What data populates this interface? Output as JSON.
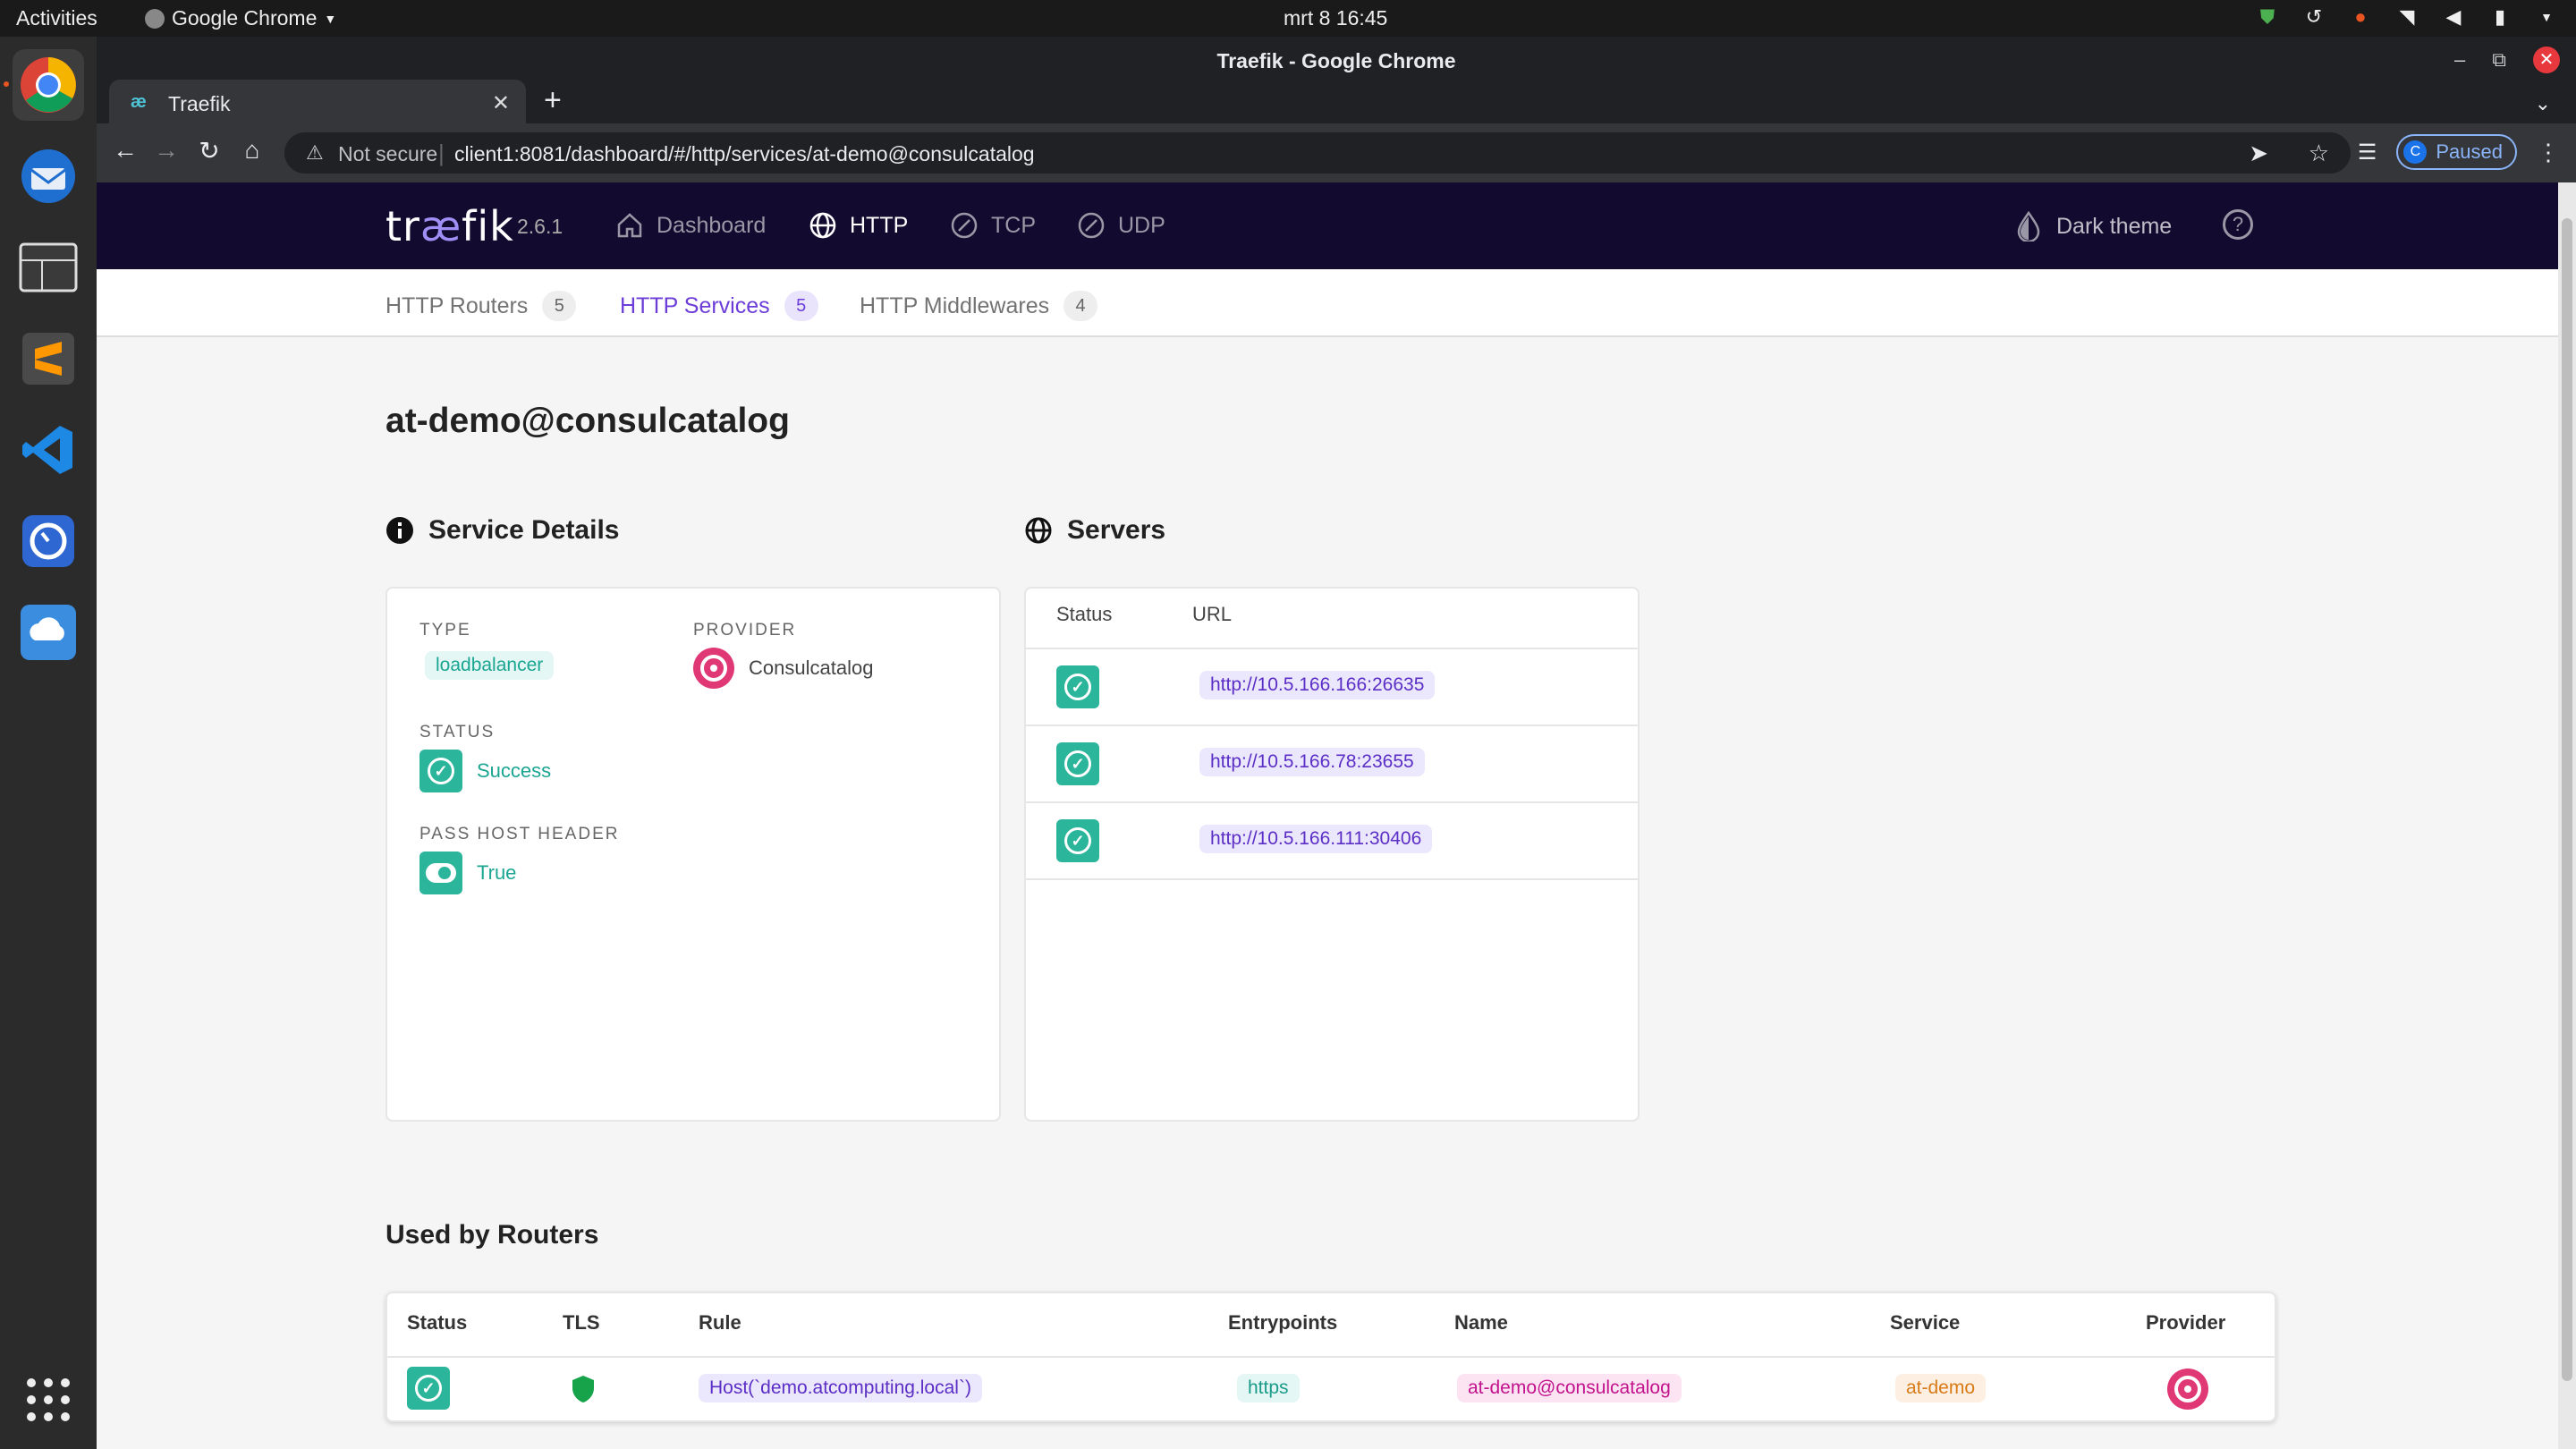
{
  "os": {
    "activities": "Activities",
    "app_menu": "Google Chrome",
    "clock": "mrt 8  16:45"
  },
  "window": {
    "title": "Traefik - Google Chrome",
    "tab_title": "Traefik",
    "not_secure": "Not secure",
    "url": "client1:8081/dashboard/#/http/services/at-demo@consulcatalog",
    "profile_initial": "C",
    "profile_status": "Paused"
  },
  "traefik": {
    "logo_pre": "tr",
    "logo_ae": "æ",
    "logo_post": "fik",
    "version": "2.6.1",
    "nav": {
      "dashboard": "Dashboard",
      "http": "HTTP",
      "tcp": "TCP",
      "udp": "UDP",
      "dark_theme": "Dark theme"
    },
    "subnav": [
      {
        "label": "HTTP Routers",
        "count": "5"
      },
      {
        "label": "HTTP Services",
        "count": "5"
      },
      {
        "label": "HTTP Middlewares",
        "count": "4"
      }
    ]
  },
  "service": {
    "name": "at-demo@consulcatalog",
    "details_title": "Service Details",
    "type_label": "TYPE",
    "type_value": "loadbalancer",
    "provider_label": "PROVIDER",
    "provider_value": "Consulcatalog",
    "status_label": "STATUS",
    "status_value": "Success",
    "pass_host_label": "PASS HOST HEADER",
    "pass_host_value": "True"
  },
  "servers": {
    "title": "Servers",
    "col_status": "Status",
    "col_url": "URL",
    "rows": [
      {
        "url": "http://10.5.166.166:26635"
      },
      {
        "url": "http://10.5.166.78:23655"
      },
      {
        "url": "http://10.5.166.111:30406"
      }
    ]
  },
  "routers": {
    "title": "Used by Routers",
    "cols": {
      "status": "Status",
      "tls": "TLS",
      "rule": "Rule",
      "entrypoints": "Entrypoints",
      "name": "Name",
      "service": "Service",
      "provider": "Provider"
    },
    "rows": [
      {
        "rule": "Host(`demo.atcomputing.local`)",
        "entrypoints": "https",
        "name": "at-demo@consulcatalog",
        "service": "at-demo"
      }
    ]
  },
  "colors": {
    "nav_bg": "#120b2f",
    "accent": "#6c3dd8",
    "success": "#2bb59b",
    "consul": "#e03875"
  }
}
